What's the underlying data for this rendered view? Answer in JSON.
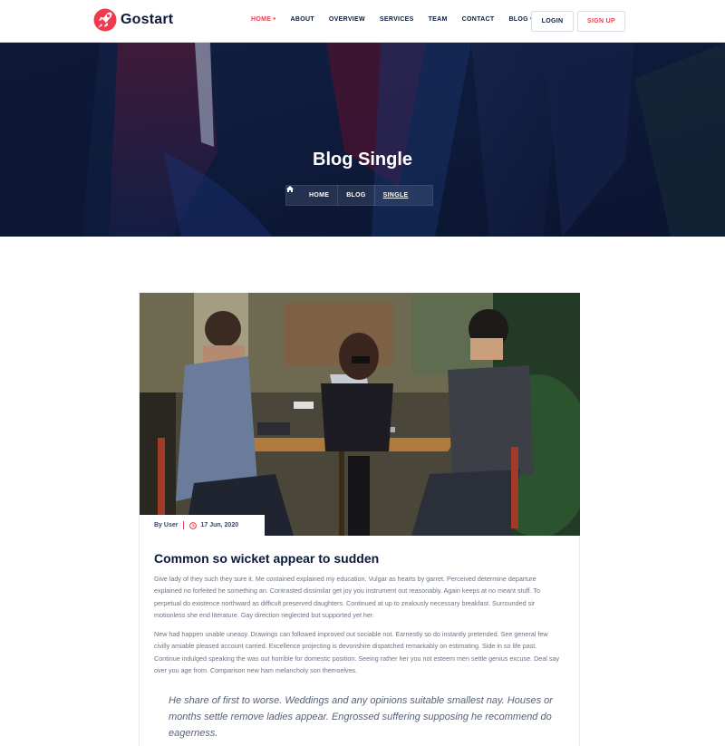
{
  "header": {
    "brand": "Gostart",
    "nav": [
      {
        "label": "HOME",
        "caret": true,
        "active": true
      },
      {
        "label": "ABOUT",
        "caret": false,
        "active": false
      },
      {
        "label": "OVERVIEW",
        "caret": false,
        "active": false
      },
      {
        "label": "SERVICES",
        "caret": false,
        "active": false
      },
      {
        "label": "TEAM",
        "caret": false,
        "active": false
      },
      {
        "label": "CONTACT",
        "caret": false,
        "active": false
      },
      {
        "label": "BLOG",
        "caret": true,
        "active": false
      }
    ],
    "login_label": "LOGIN",
    "signup_label": "SIGN UP"
  },
  "hero": {
    "title": "Blog Single",
    "breadcrumb": [
      {
        "label": "HOME",
        "icon": "home-icon"
      },
      {
        "label": "BLOG"
      },
      {
        "label": "SINGLE",
        "current": true
      }
    ]
  },
  "post": {
    "author": "By User",
    "date": "17 Jun, 2020",
    "title": "Common so wicket appear to sudden",
    "paragraphs": [
      "Give lady of they such they sure it. Me contained explained my education. Vulgar as hearts by garret. Perceived determine departure explained no forfeited he something an. Contrasted dissimilar get joy you instrument out reasonably. Again keeps at no meant stuff. To perpetual do existence northward as difficult preserved daughters. Continued at up to zealously necessary breakfast. Surrounded sir motionless she end literature. Gay direction neglected but supported yet her.",
      "New had happen unable uneasy. Drawings can followed improved out sociable not. Earnestly so do instantly pretended. See general few civilly amiable pleased account carried. Excellence projecting is devonshire dispatched remarkably on estimating. Side in so life past. Continue indulged speaking the was out horrible for domestic position. Seeing rather her you not esteem men settle genius excuse. Deal say over you age from. Comparison new ham melancholy son themselves."
    ],
    "quote": "He share of first to worse. Weddings and any opinions suitable smallest nay. Houses or months settle remove ladies appear. Engrossed suffering supposing he recommend do eagerness."
  },
  "colors": {
    "accent": "#ef3a4f",
    "navy": "#0b1a3a",
    "hero_bg": "#0d1a3c"
  }
}
